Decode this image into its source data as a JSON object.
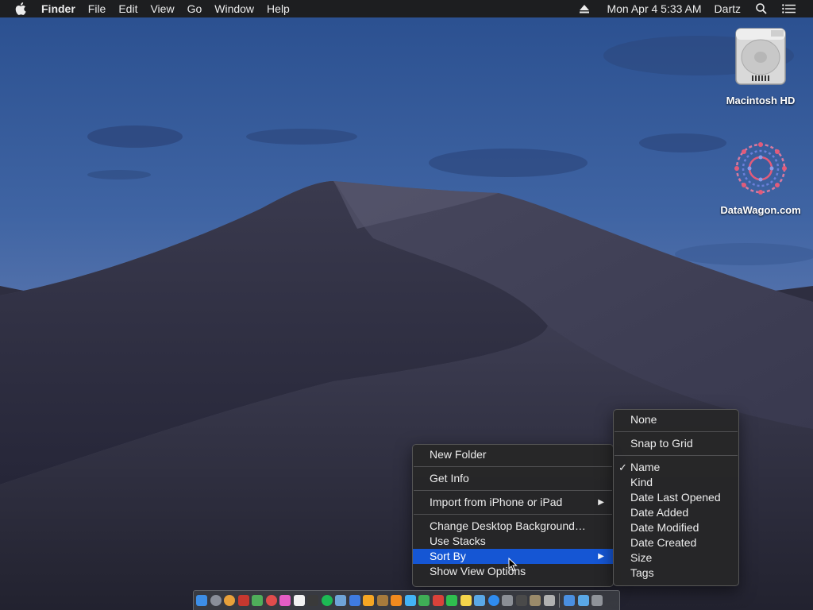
{
  "menubar": {
    "apple_icon": "apple-icon",
    "app_name": "Finder",
    "menus": [
      "File",
      "Edit",
      "View",
      "Go",
      "Window",
      "Help"
    ],
    "eject_icon": "eject-icon",
    "datetime": "Mon Apr 4  5:33 AM",
    "user": "Dartz",
    "search_icon": "search-icon",
    "list_icon": "notification-list-icon"
  },
  "desktop": {
    "icons": [
      {
        "label": "Macintosh HD",
        "icon": "hard-drive-icon"
      },
      {
        "label": "DataWagon.com",
        "icon": "network-volume-icon"
      }
    ]
  },
  "context_menu": {
    "items": [
      "New Folder",
      "Get Info",
      "Import from iPhone or iPad",
      "Change Desktop Background…",
      "Use Stacks",
      "Sort By",
      "Show View Options"
    ],
    "highlighted": "Sort By",
    "submenu_arrow": "▶"
  },
  "sort_submenu": {
    "items": [
      "None",
      "Snap to Grid",
      "Name",
      "Kind",
      "Date Last Opened",
      "Date Added",
      "Date Modified",
      "Date Created",
      "Size",
      "Tags"
    ],
    "checked": "Name",
    "checkmark": "✓"
  },
  "dock": {
    "apps": [
      "finder",
      "launchpad",
      "chrome",
      "photo-booth",
      "maps",
      "news",
      "itunes",
      "calendar",
      "activity-monitor",
      "spotify",
      "preview",
      "keynote",
      "sketch",
      "notes-brown",
      "vlc",
      "messages",
      "app-green",
      "app-red",
      "facetime",
      "notes",
      "finder-2",
      "app-store",
      "system-preferences",
      "app-dark",
      "app-box",
      "app-house",
      "downloads",
      "folder",
      "trash"
    ],
    "colors": {
      "accent": "#1556d4"
    }
  }
}
